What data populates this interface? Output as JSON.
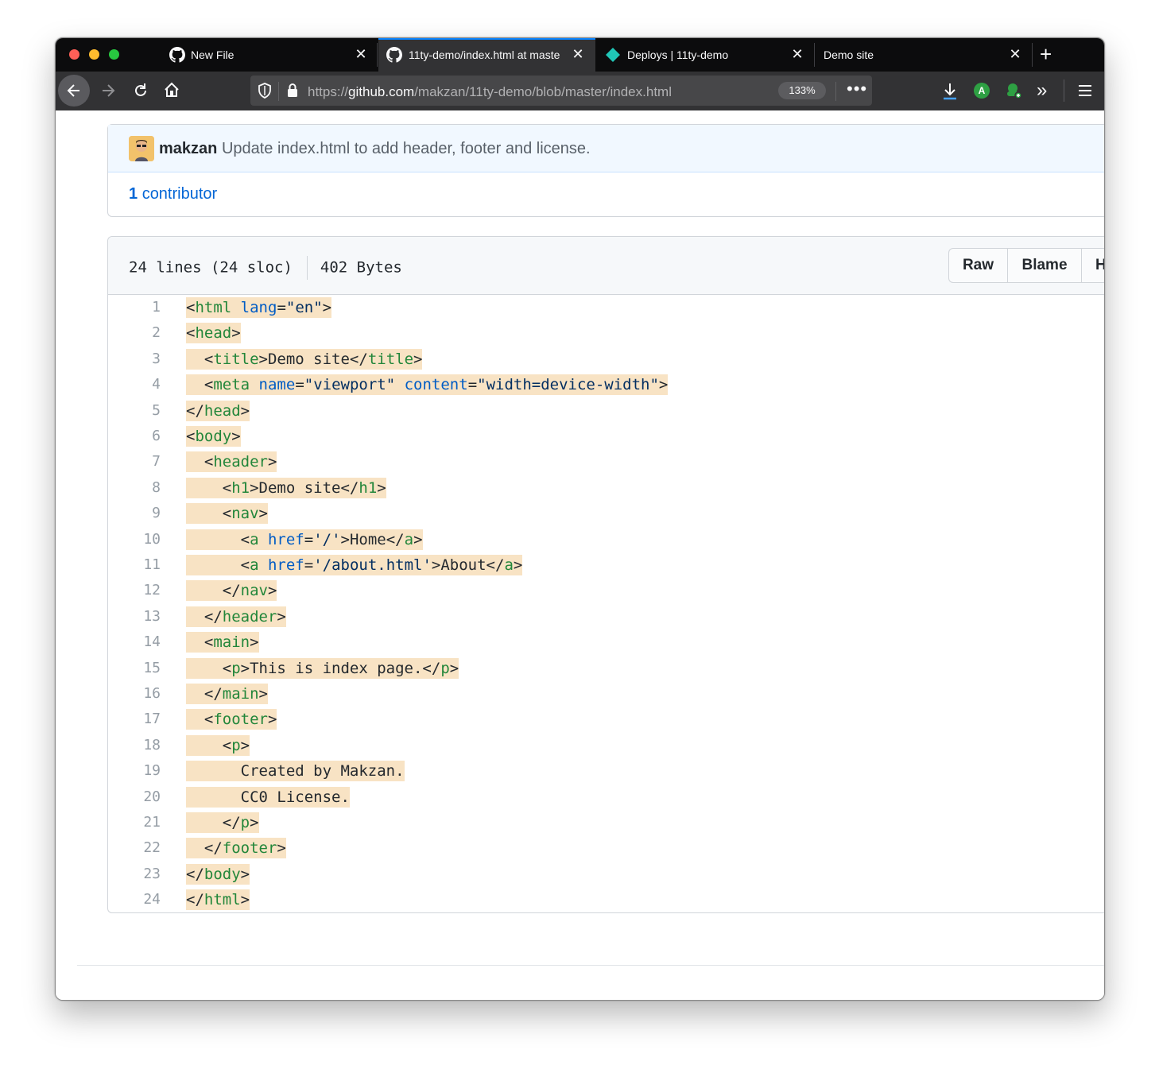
{
  "browser": {
    "tabs": [
      {
        "label": "New File",
        "icon": "github-icon"
      },
      {
        "label": "11ty-demo/index.html at maste",
        "icon": "github-icon",
        "active": true
      },
      {
        "label": "Deploys | 11ty-demo",
        "icon": "netlify-icon"
      },
      {
        "label": "Demo site",
        "icon": ""
      }
    ],
    "url_scheme": "https://",
    "url_host": "github.com",
    "url_path": "/makzan/11ty-demo/blob/master/index.html",
    "zoom": "133%",
    "accent_color": "#0a84ff"
  },
  "commit": {
    "author": "makzan",
    "message": "Update index.html to add header, footer and license.",
    "contributor_count": "1",
    "contributor_label": "contributor"
  },
  "file": {
    "lines_info": "24 lines (24 sloc)",
    "size": "402 Bytes",
    "buttons": {
      "raw": "Raw",
      "blame": "Blame",
      "history": "H"
    },
    "code": [
      {
        "num": "1",
        "parts": [
          [
            "t",
            "<"
          ],
          [
            "g",
            "html"
          ],
          [
            "t",
            " "
          ],
          [
            "a",
            "lang"
          ],
          [
            "t",
            "="
          ],
          [
            "s",
            "\"en\""
          ],
          [
            "t",
            ">"
          ]
        ]
      },
      {
        "num": "2",
        "parts": [
          [
            "t",
            "<"
          ],
          [
            "g",
            "head"
          ],
          [
            "t",
            ">"
          ]
        ]
      },
      {
        "num": "3",
        "parts": [
          [
            "t",
            "  <"
          ],
          [
            "g",
            "title"
          ],
          [
            "t",
            ">Demo site</"
          ],
          [
            "g",
            "title"
          ],
          [
            "t",
            ">"
          ]
        ]
      },
      {
        "num": "4",
        "parts": [
          [
            "t",
            "  <"
          ],
          [
            "g",
            "meta"
          ],
          [
            "t",
            " "
          ],
          [
            "a",
            "name"
          ],
          [
            "t",
            "="
          ],
          [
            "s",
            "\"viewport\""
          ],
          [
            "t",
            " "
          ],
          [
            "a",
            "content"
          ],
          [
            "t",
            "="
          ],
          [
            "s",
            "\"width=device-width\""
          ],
          [
            "t",
            ">"
          ]
        ]
      },
      {
        "num": "5",
        "parts": [
          [
            "t",
            "</"
          ],
          [
            "g",
            "head"
          ],
          [
            "t",
            ">"
          ]
        ]
      },
      {
        "num": "6",
        "parts": [
          [
            "t",
            "<"
          ],
          [
            "g",
            "body"
          ],
          [
            "t",
            ">"
          ]
        ]
      },
      {
        "num": "7",
        "parts": [
          [
            "t",
            "  <"
          ],
          [
            "g",
            "header"
          ],
          [
            "t",
            ">"
          ]
        ]
      },
      {
        "num": "8",
        "parts": [
          [
            "t",
            "    <"
          ],
          [
            "g",
            "h1"
          ],
          [
            "t",
            ">Demo site</"
          ],
          [
            "g",
            "h1"
          ],
          [
            "t",
            ">"
          ]
        ]
      },
      {
        "num": "9",
        "parts": [
          [
            "t",
            "    <"
          ],
          [
            "g",
            "nav"
          ],
          [
            "t",
            ">"
          ]
        ]
      },
      {
        "num": "10",
        "parts": [
          [
            "t",
            "      <"
          ],
          [
            "g",
            "a"
          ],
          [
            "t",
            " "
          ],
          [
            "a",
            "href"
          ],
          [
            "t",
            "="
          ],
          [
            "s",
            "'/'"
          ],
          [
            "t",
            ">Home</"
          ],
          [
            "g",
            "a"
          ],
          [
            "t",
            ">"
          ]
        ]
      },
      {
        "num": "11",
        "parts": [
          [
            "t",
            "      <"
          ],
          [
            "g",
            "a"
          ],
          [
            "t",
            " "
          ],
          [
            "a",
            "href"
          ],
          [
            "t",
            "="
          ],
          [
            "s",
            "'/about.html'"
          ],
          [
            "t",
            ">About</"
          ],
          [
            "g",
            "a"
          ],
          [
            "t",
            ">"
          ]
        ]
      },
      {
        "num": "12",
        "parts": [
          [
            "t",
            "    </"
          ],
          [
            "g",
            "nav"
          ],
          [
            "t",
            ">"
          ]
        ]
      },
      {
        "num": "13",
        "parts": [
          [
            "t",
            "  </"
          ],
          [
            "g",
            "header"
          ],
          [
            "t",
            ">"
          ]
        ]
      },
      {
        "num": "14",
        "parts": [
          [
            "t",
            "  <"
          ],
          [
            "g",
            "main"
          ],
          [
            "t",
            ">"
          ]
        ]
      },
      {
        "num": "15",
        "parts": [
          [
            "t",
            "    <"
          ],
          [
            "g",
            "p"
          ],
          [
            "t",
            ">This is index page.</"
          ],
          [
            "g",
            "p"
          ],
          [
            "t",
            ">"
          ]
        ]
      },
      {
        "num": "16",
        "parts": [
          [
            "t",
            "  </"
          ],
          [
            "g",
            "main"
          ],
          [
            "t",
            ">"
          ]
        ]
      },
      {
        "num": "17",
        "parts": [
          [
            "t",
            "  <"
          ],
          [
            "g",
            "footer"
          ],
          [
            "t",
            ">"
          ]
        ]
      },
      {
        "num": "18",
        "parts": [
          [
            "t",
            "    <"
          ],
          [
            "g",
            "p"
          ],
          [
            "t",
            ">"
          ]
        ]
      },
      {
        "num": "19",
        "parts": [
          [
            "t",
            "      Created by Makzan."
          ]
        ]
      },
      {
        "num": "20",
        "parts": [
          [
            "t",
            "      CC0 License."
          ]
        ]
      },
      {
        "num": "21",
        "parts": [
          [
            "t",
            "    </"
          ],
          [
            "g",
            "p"
          ],
          [
            "t",
            ">"
          ]
        ]
      },
      {
        "num": "22",
        "parts": [
          [
            "t",
            "  </"
          ],
          [
            "g",
            "footer"
          ],
          [
            "t",
            ">"
          ]
        ]
      },
      {
        "num": "23",
        "parts": [
          [
            "t",
            "</"
          ],
          [
            "g",
            "body"
          ],
          [
            "t",
            ">"
          ]
        ]
      },
      {
        "num": "24",
        "parts": [
          [
            "t",
            "</"
          ],
          [
            "g",
            "html"
          ],
          [
            "t",
            ">"
          ]
        ]
      }
    ]
  }
}
